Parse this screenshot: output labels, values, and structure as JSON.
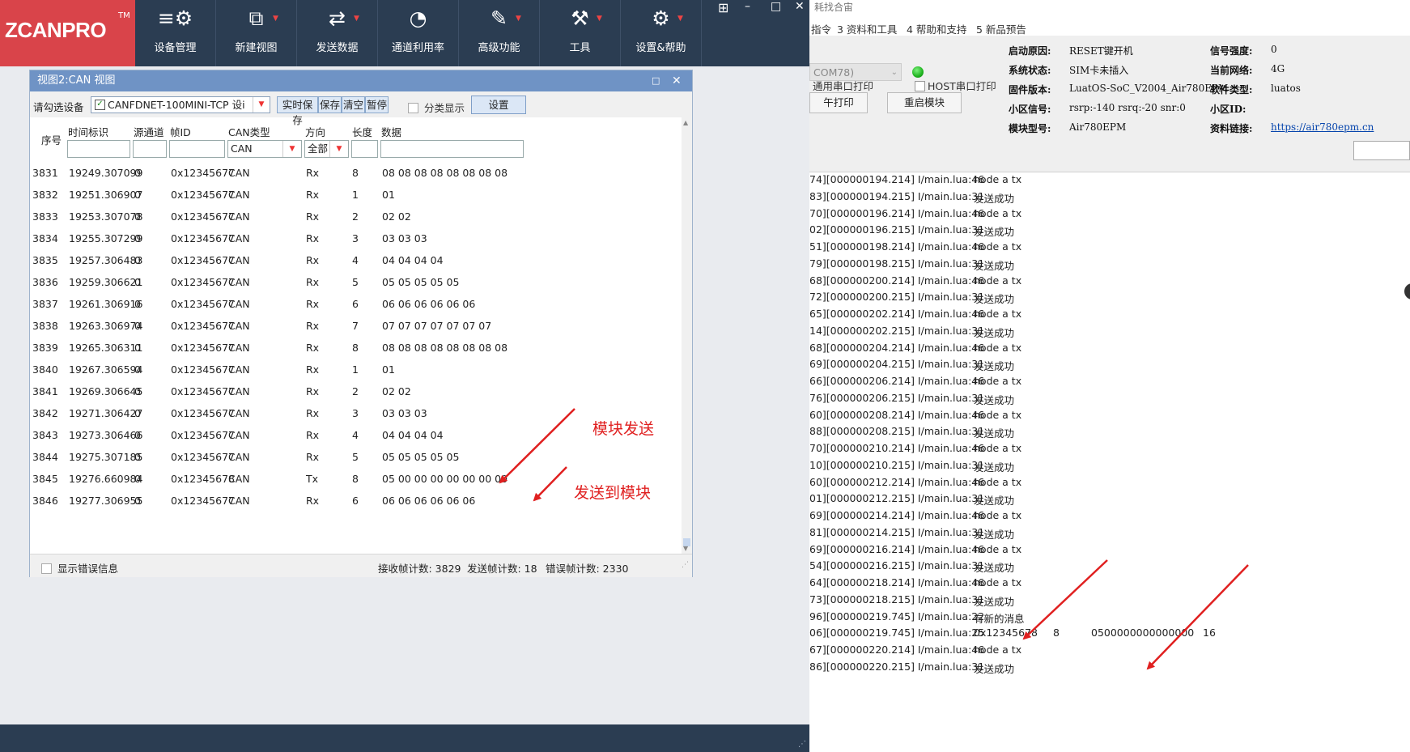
{
  "brand": {
    "logo_text": "ZCANPRO",
    "tm": "TM",
    "accent": "#d9444a",
    "toolbar_bg": "#2b3d52"
  },
  "toolbar": {
    "items": [
      {
        "icon": "device-manager-icon",
        "glyph": "≡⚙",
        "label": "设备管理",
        "has_dropdown": false
      },
      {
        "icon": "new-view-icon",
        "glyph": "⧉",
        "label": "新建视图",
        "has_dropdown": true
      },
      {
        "icon": "send-data-icon",
        "glyph": "⇄",
        "label": "发送数据",
        "has_dropdown": true
      },
      {
        "icon": "channel-usage-icon",
        "glyph": "◔",
        "label": "通道利用率",
        "has_dropdown": false
      },
      {
        "icon": "advanced-icon",
        "glyph": "✎",
        "label": "高级功能",
        "has_dropdown": true
      },
      {
        "icon": "tools-icon",
        "glyph": "⚒",
        "label": "工具",
        "has_dropdown": true
      },
      {
        "icon": "settings-help-icon",
        "glyph": "⚙",
        "label": "设置&帮助",
        "has_dropdown": true
      }
    ],
    "window_controls": {
      "grid": "⊞",
      "minimize": "–",
      "maximize": "□",
      "close": "✕"
    },
    "dropdown_glyph": "▼"
  },
  "can_window": {
    "title": "视图2:CAN 视图",
    "maximize_glyph": "□",
    "close_glyph": "✕",
    "device_label": "请勾选设备",
    "device_value": "CANFDNET-100MINI-TCP 设i",
    "device_checked": "✓",
    "buttons": {
      "realtime_save": "实时保存",
      "save": "保存",
      "clear": "清空",
      "pause": "暂停",
      "settings": "设置"
    },
    "classify_label": "分类显示",
    "columns": {
      "seq": "序号",
      "timestamp": "时间标识",
      "channel": "源通道",
      "frame_id": "帧ID",
      "can_type": "CAN类型",
      "direction": "方向",
      "length": "长度",
      "data": "数据"
    },
    "filters": {
      "can_type": "CAN",
      "direction": "全部"
    },
    "rows": [
      [
        "3831",
        "19249.307099",
        "0",
        "0x12345677",
        "CAN",
        "Rx",
        "8",
        "08 08 08 08 08 08 08 08"
      ],
      [
        "3832",
        "19251.306907",
        "0",
        "0x12345677",
        "CAN",
        "Rx",
        "1",
        "01"
      ],
      [
        "3833",
        "19253.307078",
        "0",
        "0x12345677",
        "CAN",
        "Rx",
        "2",
        "02 02"
      ],
      [
        "3834",
        "19255.307299",
        "0",
        "0x12345677",
        "CAN",
        "Rx",
        "3",
        "03 03 03"
      ],
      [
        "3835",
        "19257.306483",
        "0",
        "0x12345677",
        "CAN",
        "Rx",
        "4",
        "04 04 04 04"
      ],
      [
        "3836",
        "19259.306621",
        "0",
        "0x12345677",
        "CAN",
        "Rx",
        "5",
        "05 05 05 05 05"
      ],
      [
        "3837",
        "19261.306916",
        "0",
        "0x12345677",
        "CAN",
        "Rx",
        "6",
        "06 06 06 06 06 06"
      ],
      [
        "3838",
        "19263.306974",
        "0",
        "0x12345677",
        "CAN",
        "Rx",
        "7",
        "07 07 07 07 07 07 07"
      ],
      [
        "3839",
        "19265.306311",
        "0",
        "0x12345677",
        "CAN",
        "Rx",
        "8",
        "08 08 08 08 08 08 08 08"
      ],
      [
        "3840",
        "19267.306594",
        "0",
        "0x12345677",
        "CAN",
        "Rx",
        "1",
        "01"
      ],
      [
        "3841",
        "19269.306645",
        "0",
        "0x12345677",
        "CAN",
        "Rx",
        "2",
        "02 02"
      ],
      [
        "3842",
        "19271.306427",
        "0",
        "0x12345677",
        "CAN",
        "Rx",
        "3",
        "03 03 03"
      ],
      [
        "3843",
        "19273.306466",
        "0",
        "0x12345677",
        "CAN",
        "Rx",
        "4",
        "04 04 04 04"
      ],
      [
        "3844",
        "19275.307185",
        "0",
        "0x12345677",
        "CAN",
        "Rx",
        "5",
        "05 05 05 05 05"
      ],
      [
        "3845",
        "19276.660984",
        "0",
        "0x12345678",
        "CAN",
        "Tx",
        "8",
        "05 00 00 00 00 00 00 00"
      ],
      [
        "3846",
        "19277.306955",
        "0",
        "0x12345677",
        "CAN",
        "Rx",
        "6",
        "06 06 06 06 06 06"
      ]
    ],
    "status": {
      "show_errors": "显示错误信息",
      "rx_count": "接收帧计数: 3829",
      "tx_count": "发送帧计数: 18",
      "err_count": "错误帧计数: 2330"
    }
  },
  "annotations": {
    "module_send": "模块发送",
    "send_to_module": "发送到模块",
    "color": "#e02020"
  },
  "right_app": {
    "top_line": "耗找合宙",
    "menus": [
      "指令",
      "3 资料和工具",
      "4 帮助和支持",
      "5 新品预告"
    ],
    "checkboxes": [
      "通用串口打印",
      "HOST串口打印"
    ],
    "com_value": "COM78)",
    "buttons": {
      "print": "午打印",
      "restart": "重启模块"
    },
    "info": {
      "boot_reason": {
        "k": "启动原因:",
        "v": "RESET键开机"
      },
      "sys_state": {
        "k": "系统状态:",
        "v": "SIM卡未插入"
      },
      "firmware": {
        "k": "固件版本:",
        "v": "LuatOS-SoC_V2004_Air780EPM"
      },
      "cell_signal": {
        "k": "小区信号:",
        "v": "rsrp:-140 rsrq:-20 snr:0"
      },
      "module_model": {
        "k": "模块型号:",
        "v": "Air780EPM"
      },
      "signal_strength": {
        "k": "信号强度:",
        "v": "0"
      },
      "network": {
        "k": "当前网络:",
        "v": "4G"
      },
      "sw_type": {
        "k": "软件类型:",
        "v": "luatos"
      },
      "cell_id": {
        "k": "小区ID:",
        "v": ""
      },
      "doc_link": {
        "k": "资料链接:",
        "v": "https://air780epm.cn"
      }
    },
    "log": [
      {
        "ts": "74][000000194.214] I/main.lua:46",
        "msg": "node a tx"
      },
      {
        "ts": "83][000000194.215] I/main.lua:31",
        "msg": "发送成功"
      },
      {
        "ts": "70][000000196.214] I/main.lua:46",
        "msg": "node a tx"
      },
      {
        "ts": "02][000000196.215] I/main.lua:31",
        "msg": "发送成功"
      },
      {
        "ts": "51][000000198.214] I/main.lua:46",
        "msg": "node a tx"
      },
      {
        "ts": "79][000000198.215] I/main.lua:31",
        "msg": "发送成功"
      },
      {
        "ts": "68][000000200.214] I/main.lua:46",
        "msg": "node a tx"
      },
      {
        "ts": "72][000000200.215] I/main.lua:31",
        "msg": "发送成功"
      },
      {
        "ts": "65][000000202.214] I/main.lua:46",
        "msg": "node a tx"
      },
      {
        "ts": "14][000000202.215] I/main.lua:31",
        "msg": "发送成功"
      },
      {
        "ts": "68][000000204.214] I/main.lua:46",
        "msg": "node a tx"
      },
      {
        "ts": "69][000000204.215] I/main.lua:31",
        "msg": "发送成功"
      },
      {
        "ts": "66][000000206.214] I/main.lua:46",
        "msg": "node a tx"
      },
      {
        "ts": "76][000000206.215] I/main.lua:31",
        "msg": "发送成功"
      },
      {
        "ts": "60][000000208.214] I/main.lua:46",
        "msg": "node a tx"
      },
      {
        "ts": "88][000000208.215] I/main.lua:31",
        "msg": "发送成功"
      },
      {
        "ts": "70][000000210.214] I/main.lua:46",
        "msg": "node a tx"
      },
      {
        "ts": "10][000000210.215] I/main.lua:31",
        "msg": "发送成功"
      },
      {
        "ts": "60][000000212.214] I/main.lua:46",
        "msg": "node a tx"
      },
      {
        "ts": "01][000000212.215] I/main.lua:31",
        "msg": "发送成功"
      },
      {
        "ts": "69][000000214.214] I/main.lua:46",
        "msg": "node a tx"
      },
      {
        "ts": "81][000000214.215] I/main.lua:31",
        "msg": "发送成功"
      },
      {
        "ts": "69][000000216.214] I/main.lua:46",
        "msg": "node a tx"
      },
      {
        "ts": "54][000000216.215] I/main.lua:31",
        "msg": "发送成功"
      },
      {
        "ts": "64][000000218.214] I/main.lua:46",
        "msg": "node a tx"
      },
      {
        "ts": "73][000000218.215] I/main.lua:31",
        "msg": "发送成功"
      },
      {
        "ts": "96][000000219.745] I/main.lua:22",
        "msg": "有新的消息"
      },
      {
        "ts": "06][000000219.745] I/main.lua:25",
        "msg": "0x12345678",
        "c4": "8",
        "c5": "0500000000000000",
        "c6": "16"
      },
      {
        "ts": "67][000000220.214] I/main.lua:46",
        "msg": "node a tx"
      },
      {
        "ts": "86][000000220.215] I/main.lua:31",
        "msg": "发送成功"
      }
    ]
  }
}
